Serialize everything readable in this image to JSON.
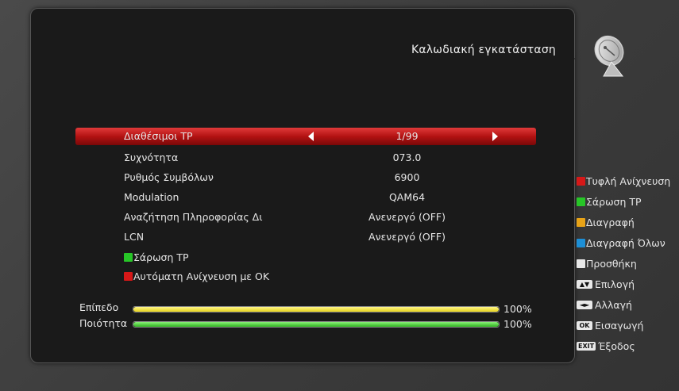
{
  "header": {
    "title": "Καλωδιακή εγκατάσταση"
  },
  "settings": [
    {
      "label": "Διαθέσιμοι TP",
      "value": "1/99",
      "selected": true
    },
    {
      "label": "Συχνότητα",
      "value": "073.0"
    },
    {
      "label": "Ρυθμός Συμβόλων",
      "value": "6900"
    },
    {
      "label": "Modulation",
      "value": "QAM64"
    },
    {
      "label": "Αναζήτηση Πληροφορίας Δι",
      "value": "Ανενεργό (OFF)"
    },
    {
      "label": "LCN",
      "value": "Ανενεργό (OFF)"
    }
  ],
  "actions": {
    "scan_tp": "Σάρωση TP",
    "auto_scan_ok": "Αυτόματη Ανίχνευση με ΟΚ"
  },
  "meters": {
    "level_label": "Επίπεδο",
    "level_value": "100%",
    "level_fraction": 1.0,
    "quality_label": "Ποιότητα",
    "quality_value": "100%",
    "quality_fraction": 1.0
  },
  "legend": {
    "red": "Τυφλή Ανίχνευση",
    "green": "Σάρωση TP",
    "yellow": "Διαγραφή",
    "blue": "Διαγραφή Όλων",
    "white": "Προσθήκη",
    "updown_key": "▲▼",
    "updown": "Επιλογή",
    "leftright_key": "◄►",
    "leftright": "Αλλαγή",
    "ok_key": "OK",
    "ok": "Εισαγωγή",
    "exit_key": "EXIT",
    "exit": "Έξοδος"
  },
  "colors": {
    "highlight": "#c41a1a",
    "red": "#d61818",
    "green": "#27c627",
    "yellow": "#e8a317",
    "blue": "#1d8fd6"
  },
  "icons": {
    "header": "satellite-dish-icon"
  }
}
